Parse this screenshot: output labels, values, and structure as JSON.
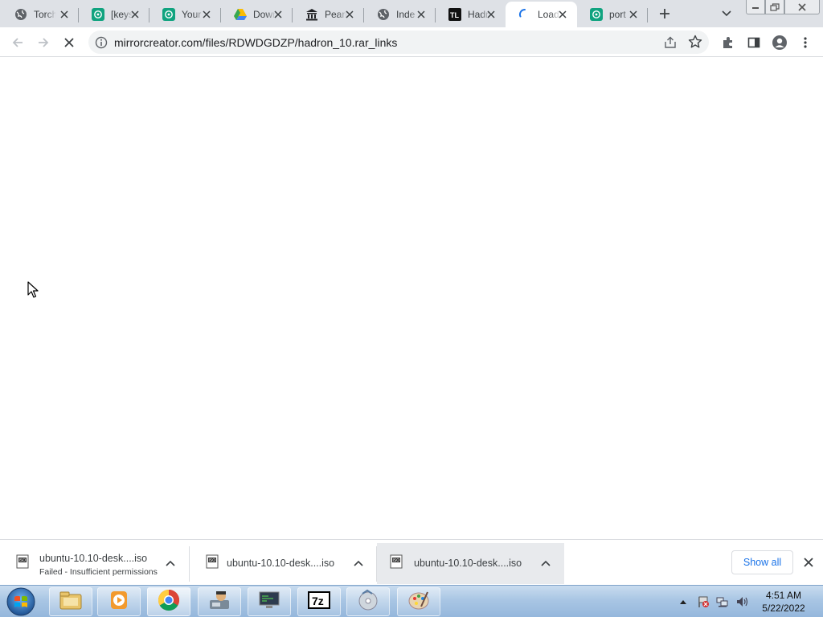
{
  "browser": {
    "tabs": [
      {
        "title": "Torch",
        "favicon": "globe-icon"
      },
      {
        "title": "[keys]",
        "favicon": "openai-icon"
      },
      {
        "title": "Your",
        "favicon": "openai-icon"
      },
      {
        "title": "Down",
        "favicon": "drive-icon"
      },
      {
        "title": "Pearl",
        "favicon": "museum-icon"
      },
      {
        "title": "Inde",
        "favicon": "globe-icon"
      },
      {
        "title": "Hadr",
        "favicon": "tl-icon"
      },
      {
        "title": "Load",
        "favicon": "loading-spinner-icon",
        "active": true
      },
      {
        "title": "port",
        "favicon": "openai-icon"
      }
    ],
    "address_bar": {
      "url": "mirrorcreator.com/files/RDWDGDZP/hadron_10.rar_links"
    }
  },
  "downloads": {
    "items": [
      {
        "filename": "ubuntu-10.10-desk....iso",
        "status": "Failed - Insufficient permissions"
      },
      {
        "filename": "ubuntu-10.10-desk....iso",
        "status": ""
      },
      {
        "filename": "ubuntu-10.10-desk....iso",
        "status": ""
      }
    ],
    "show_all_label": "Show all"
  },
  "taskbar": {
    "pinned": [
      "explorer",
      "media-player",
      "chrome",
      "app",
      "terminal",
      "7zip",
      "disc-burner",
      "paint"
    ],
    "clock": {
      "time": "4:51 AM",
      "date": "5/22/2022"
    }
  },
  "colors": {
    "accent": "#1a73e8",
    "tabstrip": "#dee1e6",
    "taskbar": "#a9c6e4"
  }
}
